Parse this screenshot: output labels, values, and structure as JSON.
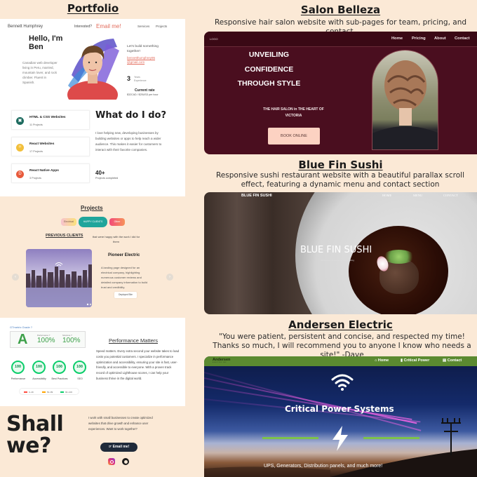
{
  "sections": {
    "portfolio": {
      "title": "Portfolio",
      "header": {
        "name": "Bennett Humphrey",
        "interested": "Interested?",
        "email_cta": "Email me!",
        "nav": [
          "Services",
          "Projects"
        ]
      },
      "hero": {
        "greeting": "Hello, I'm Ben",
        "bio": "Canadian web developer living in Peru, married, mountain lover, and rock climber. Fluent in Spanish.",
        "lets_build": "Let's build something together!",
        "email": "bennetthumphrey95 @gmail.com",
        "years_value": "3",
        "years_label": "Years Experience",
        "rate_label": "Current rate",
        "rate_value": "$32CAD / $25USD per hour"
      },
      "services": [
        {
          "title": "HTML & CSS Websites",
          "count": "11 Projects",
          "icon": "html5-icon",
          "color": "#1d6b5f"
        },
        {
          "title": "React Websites",
          "count": "17 Projects",
          "icon": "react-icon",
          "color": "#f2bf3a"
        },
        {
          "title": "React Native Apps",
          "count": "3 Projects",
          "icon": "mobile-app-icon",
          "color": "#e85a3b"
        }
      ],
      "what_do_i_do": {
        "title": "What do I do?",
        "text": "I love helping new, developing businesses by building websites or apps to help reach a wider audience. This makes it easier for customers to interact with their favorite companies.",
        "count": "40+",
        "count_label": "Projects completed"
      },
      "projects": {
        "title": "Projects",
        "filters": [
          "Electrical",
          "HAPPY CLIENTS",
          "Other"
        ],
        "active_filter": "HAPPY CLIENTS",
        "previous_clients": "PREVIOUS CLIENTS",
        "previous_text": "that were happy with the work I did for them",
        "featured": {
          "name": "Pioneer Electric",
          "description": "A landing page designed for an electrical company, highlighting numerous customer reviews and detailed company information to build trust and credibility.",
          "button": "Deployed Site"
        },
        "prev_arrow": "‹",
        "next_arrow": "›"
      },
      "performance": {
        "gtmetrix_label": "GTmetrix Grade ?",
        "grade": "A",
        "performance_label": "Performance ?",
        "performance_value": "100%",
        "structure_label": "Structure ?",
        "structure_value": "100%",
        "lighthouse": [
          {
            "score": "100",
            "label": "Performance"
          },
          {
            "score": "100",
            "label": "Accessibility"
          },
          {
            "score": "100",
            "label": "Best Practices"
          },
          {
            "score": "100",
            "label": "SEO"
          }
        ],
        "legend": [
          {
            "range": "0–49",
            "color": "#ff4e42"
          },
          {
            "range": "50–89",
            "color": "#ffa400"
          },
          {
            "range": "90–100",
            "color": "#0cce6b"
          }
        ],
        "title": "Performance Matters",
        "text": "Speed matters. Every extra second your website takes to load costs you potential customers. I specialize in performance optimization and accessibility, ensuring your site is fast, user-friendly, and accessible to everyone. With a proven track record of optimized Lighthouse scores, I can help your business thrive in the digital world."
      },
      "contact": {
        "headline_1": "Shall",
        "headline_2": "we?",
        "text": "I work with small businesses to create optimized websites that drive growth and enhance user experiences. Want to work together?",
        "button": "☞ Email me!"
      }
    },
    "salon": {
      "title": "Salon Belleza",
      "description": "Responsive hair salon website with sub-pages for team, pricing, and contact.",
      "logo": "LOGO",
      "nav": [
        "Home",
        "Pricing",
        "About",
        "Contact"
      ],
      "headline": [
        "UNVEILING",
        "CONFIDENCE",
        "THROUGH STYLE"
      ],
      "subhead": "THE HAIR SALON in THE HEART OF VICTORIA",
      "button": "BOOK ONLINE"
    },
    "sushi": {
      "title": "Blue Fin Sushi",
      "description": "Responsive sushi restaurant website with a beautiful parallax scroll effect, featuring a dynamic menu and contact section",
      "brand": "BLUE FIN SUSHI",
      "nav": [
        "HOME",
        "MENU",
        "CONTACT"
      ],
      "hero_title": "BLUE FIN SUSHI",
      "hero_tagline": "Vancouver's favourite Japanese dining"
    },
    "andersen": {
      "title": "Andersen Electric",
      "testimonial": "\"You were patient, persistent and concise, and respected my time! Thanks so much, I will recommend you to anyone I know who needs a site!\" -Dave",
      "logo": "Andersen",
      "logo_sub": "ELECTRIC INC",
      "nav": [
        "Home",
        "Critical Power",
        "Contact"
      ],
      "hero_title": "Critical Power Systems",
      "hero_sub": "UPS, Generators, Distribution panels, and much more!",
      "accent": "#5b8a30"
    }
  }
}
